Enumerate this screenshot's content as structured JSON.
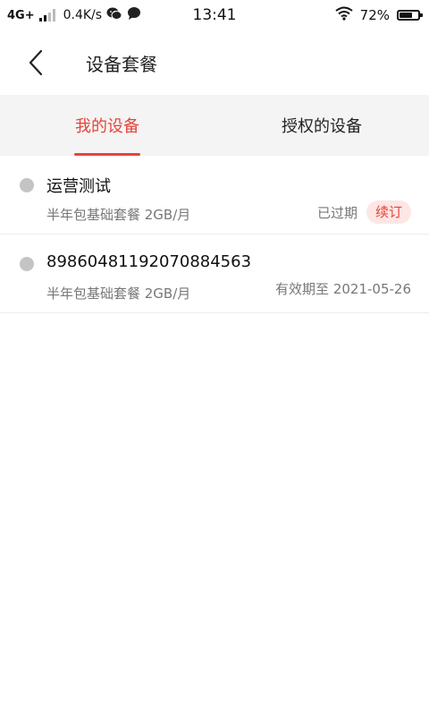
{
  "status_bar": {
    "network": "4G+",
    "speed": "0.4K/s",
    "time": "13:41",
    "battery": "72%",
    "battery_level": 0.72
  },
  "header": {
    "title": "设备套餐"
  },
  "tabs": [
    {
      "label": "我的设备",
      "active": true
    },
    {
      "label": "授权的设备",
      "active": false
    }
  ],
  "devices": [
    {
      "name": "运营测试",
      "package": "半年包基础套餐 2GB/月",
      "status": "已过期",
      "action": "续订"
    },
    {
      "name": "89860481192070884563",
      "package": "半年包基础套餐 2GB/月",
      "status": "有效期至 2021-05-26"
    }
  ],
  "colors": {
    "accent": "#e5453b",
    "tab_background": "#f4f4f4",
    "dot": "#c4c4c4"
  }
}
